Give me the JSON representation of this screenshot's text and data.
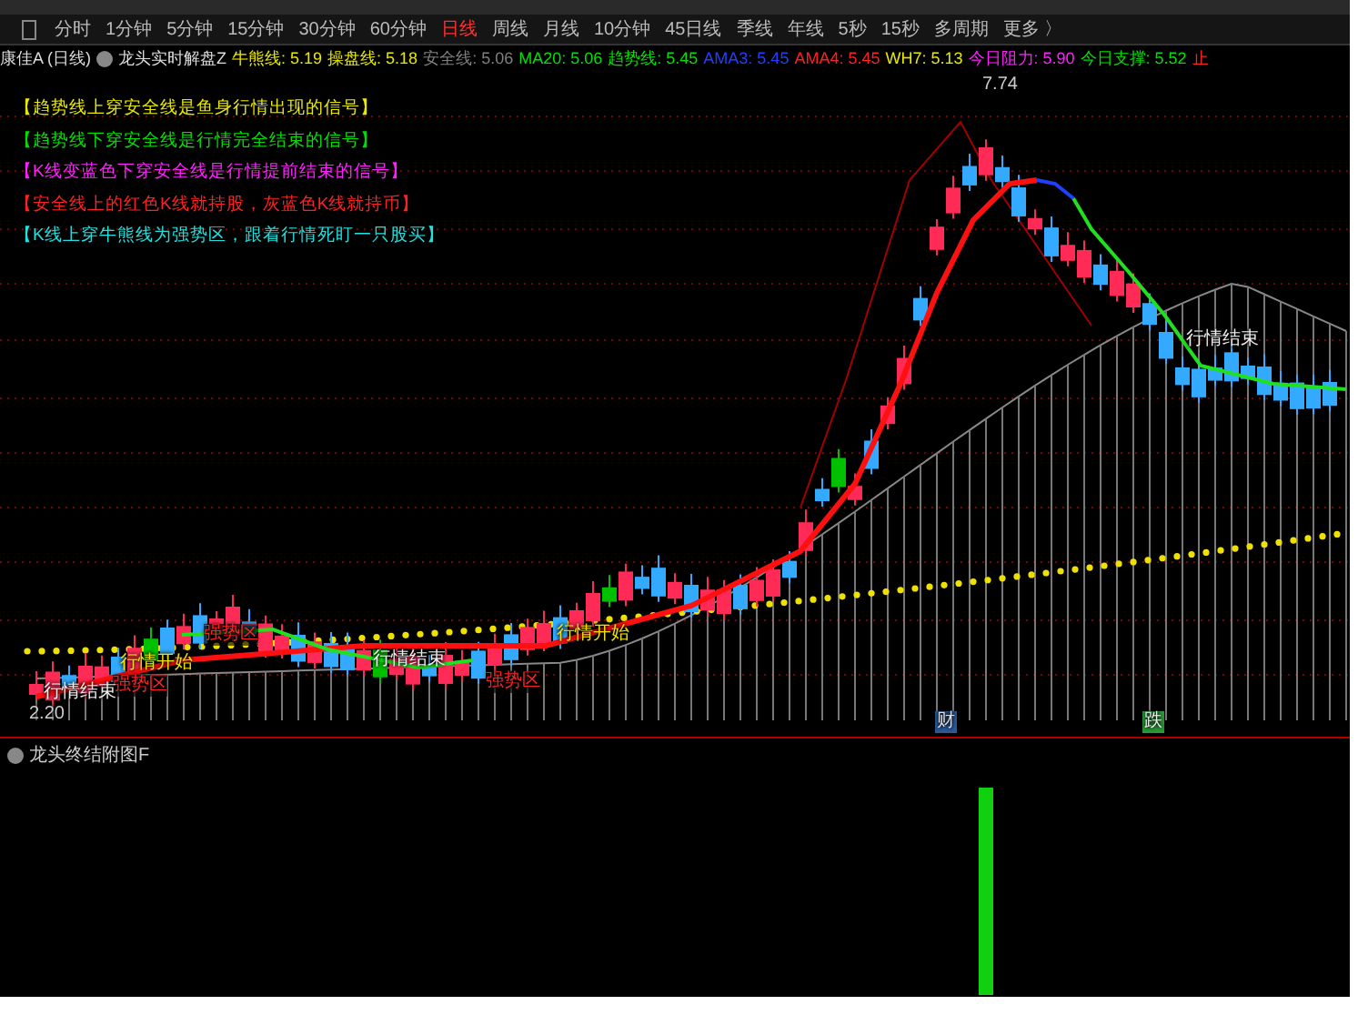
{
  "tabs": [
    {
      "label": "分时",
      "selected": false
    },
    {
      "label": "1分钟",
      "selected": false
    },
    {
      "label": "5分钟",
      "selected": false
    },
    {
      "label": "15分钟",
      "selected": false
    },
    {
      "label": "30分钟",
      "selected": false
    },
    {
      "label": "60分钟",
      "selected": false
    },
    {
      "label": "日线",
      "selected": true
    },
    {
      "label": "周线",
      "selected": false
    },
    {
      "label": "月线",
      "selected": false
    },
    {
      "label": "10分钟",
      "selected": false
    },
    {
      "label": "45日线",
      "selected": false
    },
    {
      "label": "季线",
      "selected": false
    },
    {
      "label": "年线",
      "selected": false
    },
    {
      "label": "5秒",
      "selected": false
    },
    {
      "label": "15秒",
      "selected": false
    },
    {
      "label": "多周期",
      "selected": false
    },
    {
      "label": "更多 〉",
      "selected": false
    }
  ],
  "info_bar": {
    "security": "康佳A (日线)",
    "indicator_name": "龙头实时解盘Z",
    "values": [
      {
        "text": "牛熊线: 5.19",
        "color": "#e8e800"
      },
      {
        "text": "操盘线: 5.18",
        "color": "#e8e800"
      },
      {
        "text": "安全线: 5.06",
        "color": "#808080"
      },
      {
        "text": "MA20: 5.06",
        "color": "#00e000"
      },
      {
        "text": "趋势线: 5.45",
        "color": "#00e000"
      },
      {
        "text": "AMA3: 5.45",
        "color": "#2040ff"
      },
      {
        "text": "AMA4: 5.45",
        "color": "#ff2020"
      },
      {
        "text": "WH7: 5.13",
        "color": "#e8e800"
      },
      {
        "text": "今日阻力: 5.90",
        "color": "#ff20ff"
      },
      {
        "text": "今日支撑: 5.52",
        "color": "#00e000"
      },
      {
        "text": "止",
        "color": "#ff2020"
      }
    ]
  },
  "legend": [
    {
      "text": "【趋势线上穿安全线是鱼身行情出现的信号】",
      "color": "#e8e800"
    },
    {
      "text": "【趋势线下穿安全线是行情完全结束的信号】",
      "color": "#00e000"
    },
    {
      "text": "【K线变蓝色下穿安全线是行情提前结束的信号】",
      "color": "#ff20ff"
    },
    {
      "text": "【安全线上的红色K线就持股，灰蓝色K线就持币】",
      "color": "#ff2020"
    },
    {
      "text": "【K线上穿牛熊线为强势区，跟着行情死盯一只股买】",
      "color": "#20e0e0"
    }
  ],
  "chart_labels": [
    {
      "text": "7.74",
      "kind": "price"
    },
    {
      "text": "行情结束",
      "kind": "end"
    },
    {
      "text": "行情开始",
      "kind": "start"
    },
    {
      "text": "强势区",
      "kind": "zone"
    },
    {
      "text": "行情结束",
      "kind": "end"
    },
    {
      "text": "强势区",
      "kind": "zone"
    },
    {
      "text": "强势区",
      "kind": "zone"
    },
    {
      "text": "行情开始",
      "kind": "start"
    },
    {
      "text": "行情结束",
      "kind": "end"
    },
    {
      "text": "2.20",
      "kind": "price"
    },
    {
      "text": "财",
      "kind": "finance"
    },
    {
      "text": "跌",
      "kind": "fall"
    }
  ],
  "sub_panel": {
    "title": "龙头终结附图F"
  }
}
